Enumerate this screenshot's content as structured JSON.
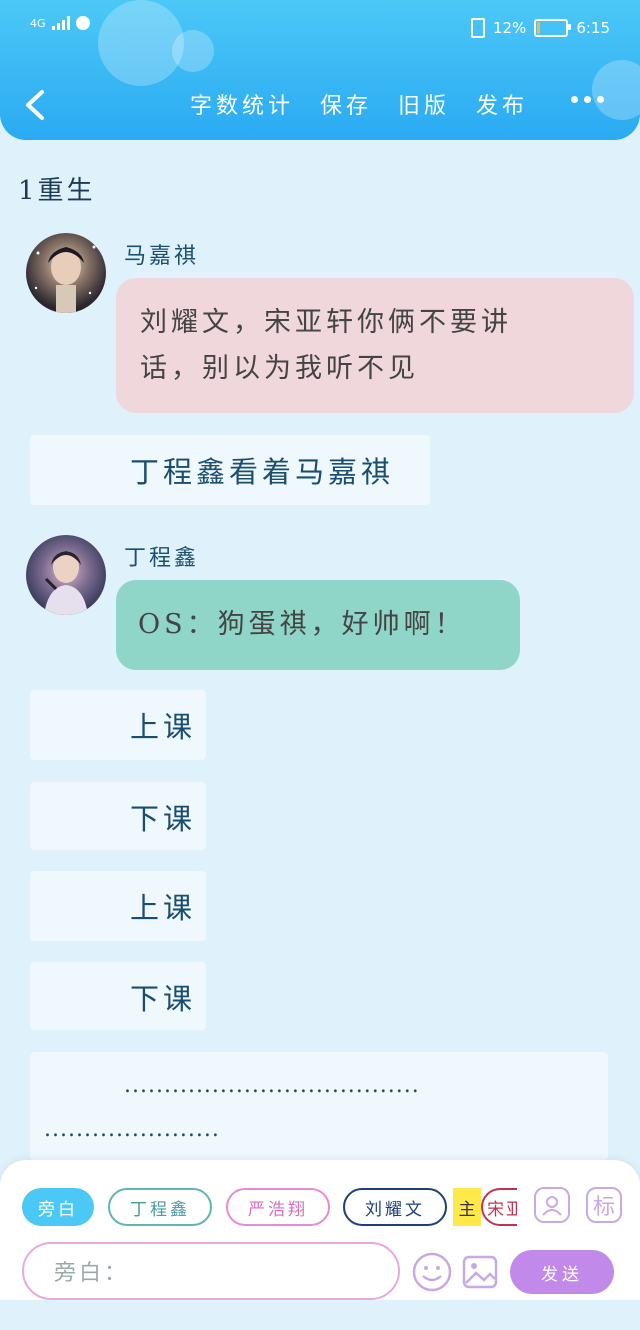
{
  "status_bar": {
    "network": "4G",
    "battery_percent": "12%",
    "time": "6:15",
    "battery_level": 0.12
  },
  "toolbar": {
    "items": [
      "字数统计",
      "保存",
      "旧版",
      "发布"
    ]
  },
  "chapter": {
    "title": "1重生"
  },
  "messages": [
    {
      "type": "dialogue",
      "speaker": "马嘉祺",
      "text_line1": "刘耀文，宋亚轩你俩不要讲",
      "text_line2": "话，别以为我听不见",
      "color": "#f0d7dc"
    },
    {
      "type": "narration",
      "text": "丁程鑫看着马嘉祺"
    },
    {
      "type": "dialogue",
      "speaker": "丁程鑫",
      "text": "OS：狗蛋祺，好帅啊！",
      "color": "#8fd6c8"
    },
    {
      "type": "narration",
      "text": "上课"
    },
    {
      "type": "narration",
      "text": "下课"
    },
    {
      "type": "narration",
      "text": "上课"
    },
    {
      "type": "narration",
      "text": "下课"
    },
    {
      "type": "narration",
      "text_line1": ".....................................",
      "text_line2": "......................"
    }
  ],
  "roles": {
    "narrator": "旁白",
    "role1": "丁程鑫",
    "role2": "严浩翔",
    "role3": "刘耀文",
    "main_badge": "主",
    "role4": "宋亚"
  },
  "icons": {
    "add_role": "add-person-icon",
    "tag": "标"
  },
  "input": {
    "placeholder": "旁白："
  },
  "send": {
    "label": "发送"
  }
}
